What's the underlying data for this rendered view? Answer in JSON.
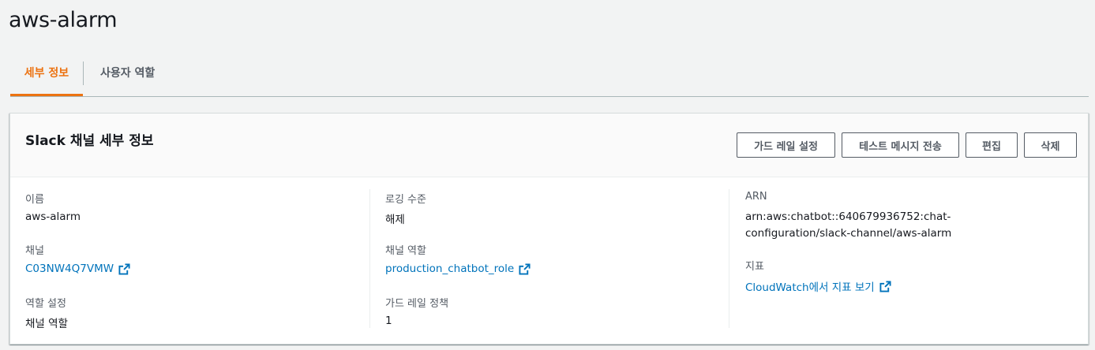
{
  "page": {
    "title": "aws-alarm"
  },
  "tabs": [
    {
      "label": "세부 정보",
      "active": true
    },
    {
      "label": "사용자 역할",
      "active": false
    }
  ],
  "panel": {
    "title": "Slack 채널 세부 정보",
    "buttons": {
      "guardrails": "가드 레일 설정",
      "test_message": "테스트 메시지 전송",
      "edit": "편집",
      "delete": "삭제"
    }
  },
  "details": {
    "col1": {
      "name_label": "이름",
      "name_value": "aws-alarm",
      "channel_label": "채널",
      "channel_value": "C03NW4Q7VMW",
      "role_setting_label": "역할 설정",
      "role_setting_value": "채널 역할"
    },
    "col2": {
      "logging_label": "로깅 수준",
      "logging_value": "해제",
      "channel_role_label": "채널 역할",
      "channel_role_value": "production_chatbot_role",
      "guardrail_policy_label": "가드 레일 정책",
      "guardrail_policy_value": "1"
    },
    "col3": {
      "arn_label": "ARN",
      "arn_value": "arn:aws:chatbot::640679936752:chat-configuration/slack-channel/aws-alarm",
      "metrics_label": "지표",
      "metrics_value": "CloudWatch에서 지표 보기"
    }
  },
  "colors": {
    "accent": "#ec7211",
    "link": "#0073bb",
    "text": "#16191f",
    "muted": "#545b64"
  },
  "icons": {
    "external_link": "external-link-icon"
  }
}
